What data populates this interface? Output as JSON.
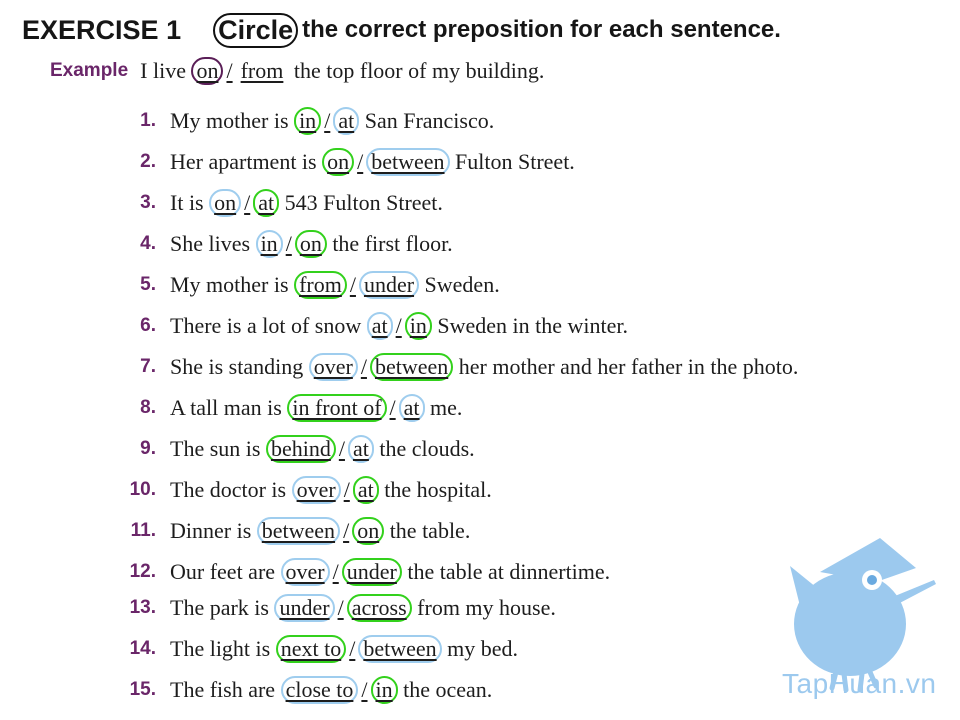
{
  "header": {
    "exercise_label": "EXERCISE",
    "exercise_number": "1",
    "circle_word": "Circle",
    "instruction_rest": "the correct preposition for each sentence."
  },
  "example": {
    "label": "Example",
    "before": "I live ",
    "opt1": "on",
    "opt2": "from",
    "after": " the top floor of my building."
  },
  "items": [
    {
      "num": "1.",
      "before": "My mother is ",
      "opt1": "in",
      "opt2": "at",
      "after": " San Francisco.",
      "circled": 1
    },
    {
      "num": "2.",
      "before": "Her apartment is ",
      "opt1": "on",
      "opt2": "between",
      "after": " Fulton Street.",
      "circled": 1
    },
    {
      "num": "3.",
      "before": "It is ",
      "opt1": "on",
      "opt2": "at",
      "after": " 543 Fulton Street.",
      "circled": 2
    },
    {
      "num": "4.",
      "before": "She lives ",
      "opt1": "in",
      "opt2": "on",
      "after": " the first floor.",
      "circled": 2
    },
    {
      "num": "5.",
      "before": "My mother is ",
      "opt1": "from",
      "opt2": "under",
      "after": " Sweden.",
      "circled": 1
    },
    {
      "num": "6.",
      "before": "There is a lot of snow ",
      "opt1": "at",
      "opt2": "in",
      "after": " Sweden in the winter.",
      "circled": 2
    },
    {
      "num": "7.",
      "before": "She is standing ",
      "opt1": "over",
      "opt2": "between",
      "after": " her mother and her father in the photo.",
      "circled": 2
    },
    {
      "num": "8.",
      "before": "A tall man is ",
      "opt1": "in front of",
      "opt2": "at",
      "after": " me.",
      "circled": 1
    },
    {
      "num": "9.",
      "before": "The sun is ",
      "opt1": "behind",
      "opt2": "at",
      "after": " the clouds.",
      "circled": 1
    },
    {
      "num": "10.",
      "before": "The doctor is ",
      "opt1": "over",
      "opt2": "at",
      "after": " the hospital.",
      "circled": 2
    },
    {
      "num": "11.",
      "before": "Dinner is ",
      "opt1": "between",
      "opt2": "on",
      "after": " the table.",
      "circled": 2
    },
    {
      "num": "12.",
      "before": "Our feet are ",
      "opt1": "over",
      "opt2": "under",
      "after": " the table at dinnertime.",
      "circled": 2
    },
    {
      "num": "13.",
      "before": "The park is ",
      "opt1": "under",
      "opt2": "across",
      "after": " from my house.",
      "circled": 2
    },
    {
      "num": "14.",
      "before": "The light is ",
      "opt1": "next to",
      "opt2": "between",
      "after": " my bed.",
      "circled": 1
    },
    {
      "num": "15.",
      "before": "The fish are ",
      "opt1": "close to",
      "opt2": "in",
      "after": " the ocean.",
      "circled": 2
    }
  ],
  "watermark": {
    "text": "TapHuan.vn",
    "icon": "owl-teacher-icon"
  },
  "colors": {
    "number": "#6a2669",
    "correct_circle": "#33d11c",
    "other_circle": "#9fcdee",
    "example_circle": "#5a1e57",
    "watermark": "#9cc9ee"
  }
}
